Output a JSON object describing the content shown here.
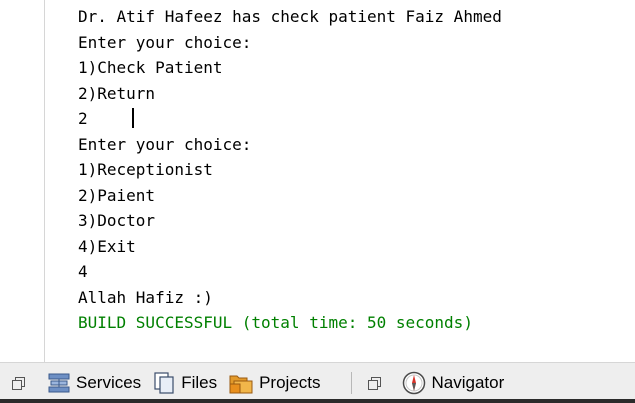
{
  "console": {
    "lines": [
      "Dr. Atif Hafeez has check patient Faiz Ahmed",
      "Enter your choice:",
      "1)Check Patient",
      "2)Return",
      "2",
      "Enter your choice:",
      "1)Receptionist",
      "2)Paient",
      "3)Doctor",
      "4)Exit",
      "4",
      "Allah Hafiz :)",
      "BUILD SUCCESSFUL (total time: 50 seconds)"
    ],
    "success_color": "#008000"
  },
  "tabbar": {
    "tabs": [
      {
        "label": "Services",
        "icon": "services-icon"
      },
      {
        "label": "Files",
        "icon": "files-icon"
      },
      {
        "label": "Projects",
        "icon": "projects-icon"
      },
      {
        "label": "Navigator",
        "icon": "navigator-icon"
      }
    ]
  }
}
